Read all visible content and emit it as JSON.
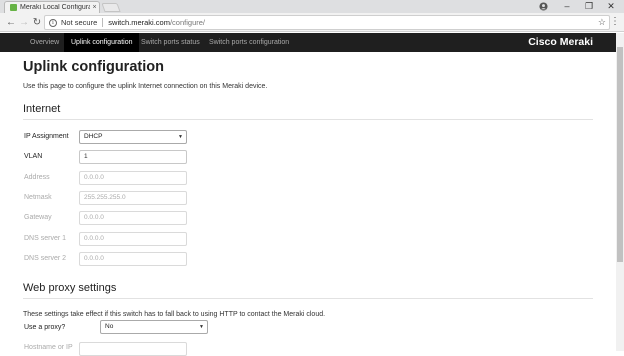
{
  "browser": {
    "tab_title": "Meraki Local Configura",
    "tab_close": "×",
    "security_label": "Not secure",
    "url_host": "switch.meraki.com",
    "url_path": "/configure/",
    "window_controls": {
      "minimize": "–",
      "maximize": "❐",
      "close": "✕"
    },
    "profile_icon": "person-icon",
    "star_icon": "star-icon"
  },
  "nav": {
    "tabs": [
      {
        "label": "Overview",
        "active": false
      },
      {
        "label": "Uplink configuration",
        "active": true
      },
      {
        "label": "Switch ports status",
        "active": false
      },
      {
        "label": "Switch ports configuration",
        "active": false
      }
    ],
    "brand": "Cisco Meraki"
  },
  "page": {
    "title": "Uplink configuration",
    "description": "Use this page to configure the uplink Internet connection on this Meraki device.",
    "internet": {
      "heading": "Internet",
      "ip_assignment": {
        "label": "IP Assignment",
        "value": "DHCP"
      },
      "vlan": {
        "label": "VLAN",
        "value": "1"
      },
      "address": {
        "label": "Address",
        "placeholder": "0.0.0.0"
      },
      "netmask": {
        "label": "Netmask",
        "placeholder": "255.255.255.0"
      },
      "gateway": {
        "label": "Gateway",
        "placeholder": "0.0.0.0"
      },
      "dns1": {
        "label": "DNS server 1",
        "placeholder": "0.0.0.0"
      },
      "dns2": {
        "label": "DNS server 2",
        "placeholder": "0.0.0.0"
      }
    },
    "proxy": {
      "heading": "Web proxy settings",
      "note": "These settings take effect if this switch has to fall back to using HTTP to contact the Meraki cloud.",
      "use_proxy": {
        "label": "Use a proxy?",
        "value": "No"
      },
      "hostname": {
        "label": "Hostname or IP"
      }
    }
  },
  "colors": {
    "nav_bg": "#1f1f1f",
    "nav_active": "#000000",
    "favicon": "#67b346"
  }
}
